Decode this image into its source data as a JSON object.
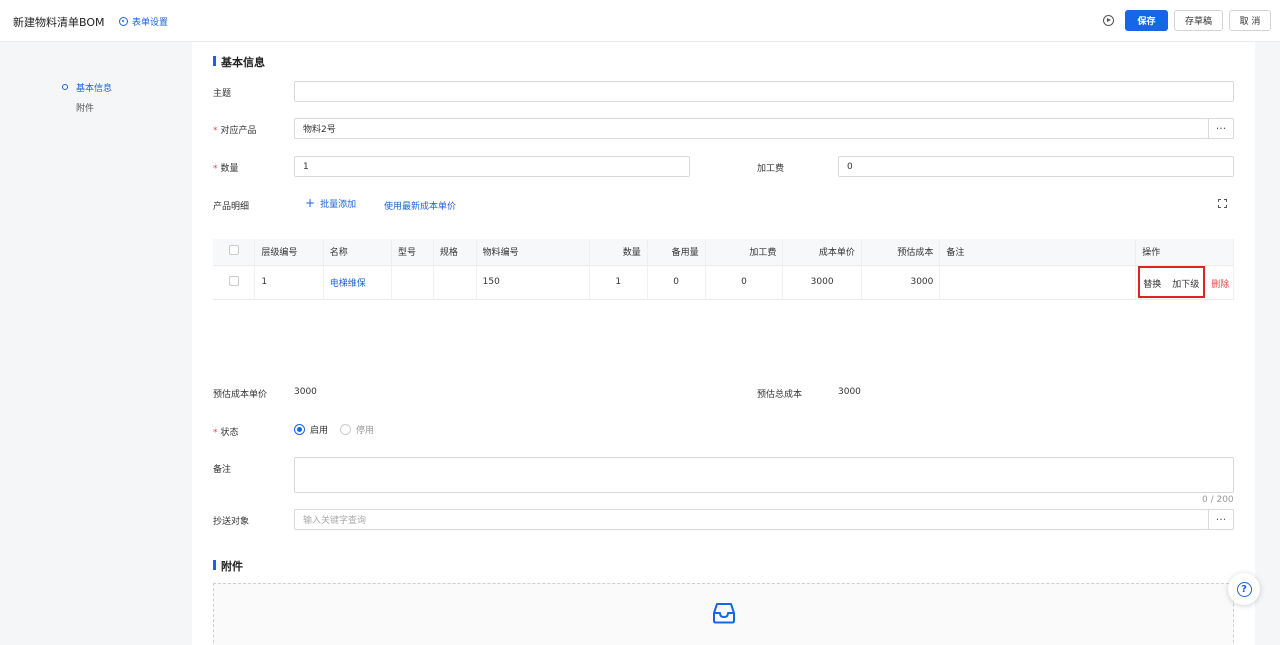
{
  "header": {
    "title": "新建物料清单BOM",
    "form_settings": "表单设置",
    "save": "保存",
    "draft": "存草稿",
    "cancel": "取 消"
  },
  "side_nav": {
    "items": [
      {
        "label": "基本信息",
        "active": true
      },
      {
        "label": "附件",
        "active": false
      }
    ]
  },
  "basic": {
    "section_title": "基本信息",
    "subject_label": "主题",
    "subject_value": "",
    "product_label": "对应产品",
    "product_value": "物料2号",
    "quantity_label": "数量",
    "quantity_value": "1",
    "processing_fee_label": "加工费",
    "processing_fee_value": "0",
    "details_label": "产品明细",
    "batch_add": "批量添加",
    "use_latest_cost": "使用最新成本单价"
  },
  "table": {
    "columns": [
      "层级编号",
      "名称",
      "型号",
      "规格",
      "物料编号",
      "数量",
      "备用量",
      "加工费",
      "成本单价",
      "预估成本",
      "备注",
      "操作"
    ],
    "rows": [
      {
        "level": "1",
        "name": "电梯维保",
        "model": "",
        "spec": "",
        "material_no": "150",
        "quantity": "1",
        "spare": "0",
        "processing_fee": "0",
        "unit_cost": "3000",
        "est_cost": "3000",
        "remark": "",
        "actions": {
          "replace": "替换",
          "add_sub": "加下级",
          "delete": "删除"
        }
      }
    ]
  },
  "summary": {
    "est_unit_cost_label": "预估成本单价",
    "est_unit_cost_value": "3000",
    "est_total_cost_label": "预估总成本",
    "est_total_cost_value": "3000"
  },
  "status": {
    "label": "状态",
    "options": [
      "启用",
      "停用"
    ],
    "selected": "启用"
  },
  "remark": {
    "label": "备注",
    "counter": "0 / 200"
  },
  "cc": {
    "label": "抄送对象",
    "placeholder": "输入关键字查询"
  },
  "attachment": {
    "section_title": "附件"
  },
  "colors": {
    "primary": "#1766e6",
    "danger": "#e5484d",
    "highlight_box": "#e02424"
  }
}
